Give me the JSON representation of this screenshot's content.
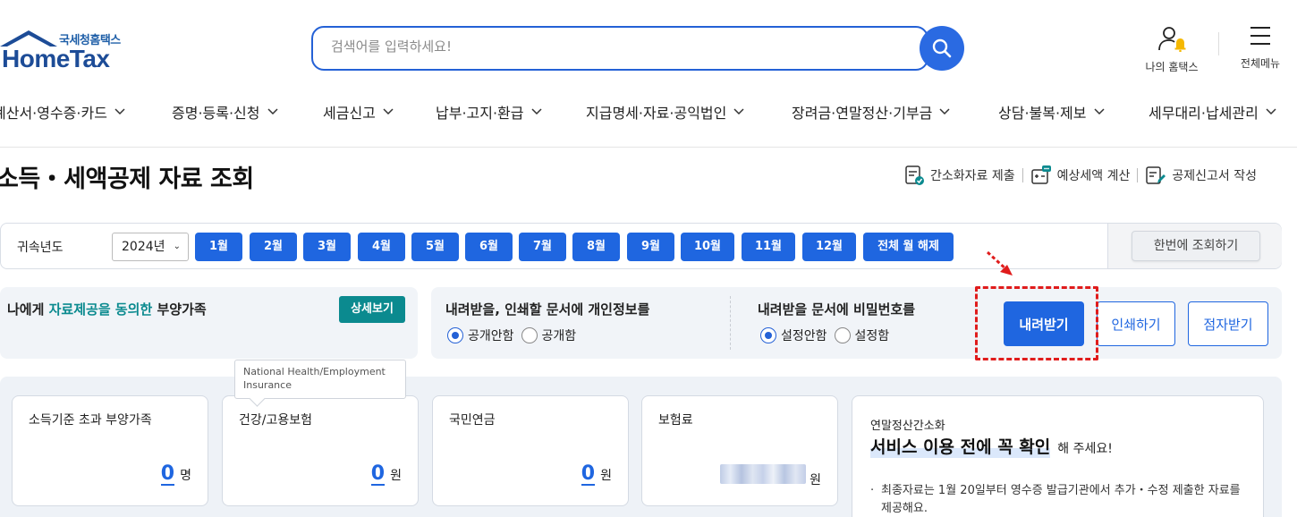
{
  "header": {
    "logo_sub": "국세청홈택스",
    "logo_main": "HomeTax",
    "search_placeholder": "검색어를 입력하세요!",
    "my_hometax_label": "나의 홈택스",
    "all_menu_label": "전체메뉴"
  },
  "gnb": {
    "items": [
      "계산서·영수증·카드",
      "증명·등록·신청",
      "세금신고",
      "납부·고지·환급",
      "지급명세·자료·공익법인",
      "장려금·연말정산·기부금",
      "상담·불복·제보",
      "세무대리·납세관리"
    ]
  },
  "page": {
    "title": "소득・세액공제 자료 조회",
    "links": [
      "간소화자료 제출",
      "예상세액 계산",
      "공제신고서 작성"
    ]
  },
  "month_row": {
    "year_label": "귀속년도",
    "year_value": "2024년",
    "months": [
      "1월",
      "2월",
      "3월",
      "4월",
      "5월",
      "6월",
      "7월",
      "8월",
      "9월",
      "10월",
      "11월",
      "12월"
    ],
    "clear_all": "전체 월 해제",
    "query_all": "한번에 조회하기"
  },
  "dependents": {
    "text_prefix": "나에게 ",
    "text_highlight": "자료제공을 동의한",
    "text_suffix": " 부양가족",
    "detail_button": "상세보기"
  },
  "options": {
    "privacy_title": "내려받을, 인쇄할 문서에 개인정보를",
    "privacy_options": [
      "공개안함",
      "공개함"
    ],
    "privacy_selected": 0,
    "password_title": "내려받을 문서에 비밀번호를",
    "password_options": [
      "설정안함",
      "설정함"
    ],
    "password_selected": 0
  },
  "actions": {
    "download": "내려받기",
    "print": "인쇄하기",
    "braille": "점자받기"
  },
  "tooltip": "National Health/Employment Insurance",
  "cards": [
    {
      "title": "소득기준 초과 부양가족",
      "value": "0",
      "unit": "명"
    },
    {
      "title": "건강/고용보험",
      "value": "0",
      "unit": "원"
    },
    {
      "title": "국민연금",
      "value": "0",
      "unit": "원"
    },
    {
      "title": "보험료",
      "value": "",
      "unit": "원"
    }
  ],
  "notice": {
    "subtitle": "연말정산간소화",
    "title_big": "서비스 이용 전에 꼭 확인",
    "title_small": "해 주세요!",
    "body": "최종자료는 1월 20일부터 영수증 발급기관에서 추가・수정 제출한 자료를 제공해요."
  },
  "colors": {
    "primary": "#1f66e0",
    "teal": "#0b8a8f",
    "annotation_red": "#e01c1c"
  }
}
